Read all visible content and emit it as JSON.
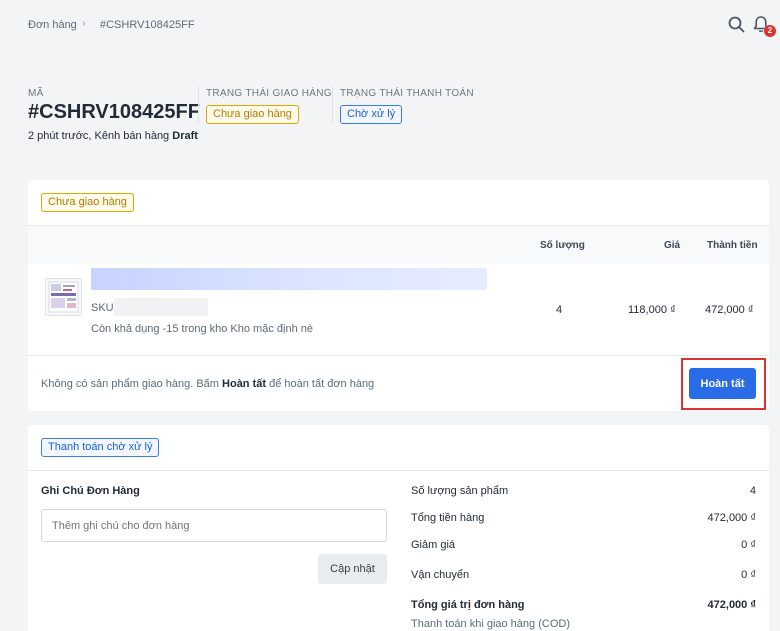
{
  "breadcrumb": {
    "parent": "Đơn hàng",
    "separator": "›",
    "current": "#CSHRV108425FF"
  },
  "header": {
    "notification_count": "2"
  },
  "order": {
    "code_label": "MÃ",
    "code": "#CSHRV108425FF",
    "meta_prefix": "2 phút trước, Kênh bán hàng",
    "meta_channel": "Draft",
    "shipping_status_label": "TRẠNG THÁI GIAO HÀNG",
    "shipping_status": "Chưa giao hàng",
    "payment_status_label": "TRẠNG THÁI THANH TOÁN",
    "payment_status": "Chờ xử lý"
  },
  "fulfillment": {
    "status_tag": "Chưa giao hàng",
    "columns": {
      "qty": "Số lượng",
      "price": "Giá",
      "total": "Thành tiền"
    },
    "item": {
      "sku_label": "SKU",
      "availability": "Còn khả dụng -15 trong kho Kho mặc định nè",
      "qty": "4",
      "price": "118,000 ₫",
      "total": "472,000 ₫"
    },
    "footer_prefix": "Không có sản phẩm giao hàng. Bấm",
    "footer_bold": "Hoàn tất",
    "footer_suffix": "để hoàn tất đơn hàng",
    "complete_button": "Hoàn tất"
  },
  "payment": {
    "status_tag": "Thanh toán chờ xử lý",
    "note_title": "Ghi Chú Đơn Hàng",
    "note_placeholder": "Thêm ghi chú cho đơn hàng",
    "update_button": "Cập nhật",
    "summary": {
      "qty_label": "Số lượng sản phẩm",
      "qty_value": "4",
      "subtotal_label": "Tổng tiền hàng",
      "subtotal_value": "472,000 ₫",
      "discount_label": "Giảm giá",
      "discount_value": "0 ₫",
      "shipping_label": "Vận chuyển",
      "shipping_value": "0 ₫",
      "grand_label": "Tổng giá trị đơn hàng",
      "grand_value": "472,000 ₫",
      "cod_label": "Thanh toán khi giao hàng (COD)"
    }
  },
  "colors": {
    "primary": "#2a6be8",
    "highlight": "#e03131",
    "tag_yellow": "#e0a800",
    "tag_blue": "#3a7be6"
  }
}
